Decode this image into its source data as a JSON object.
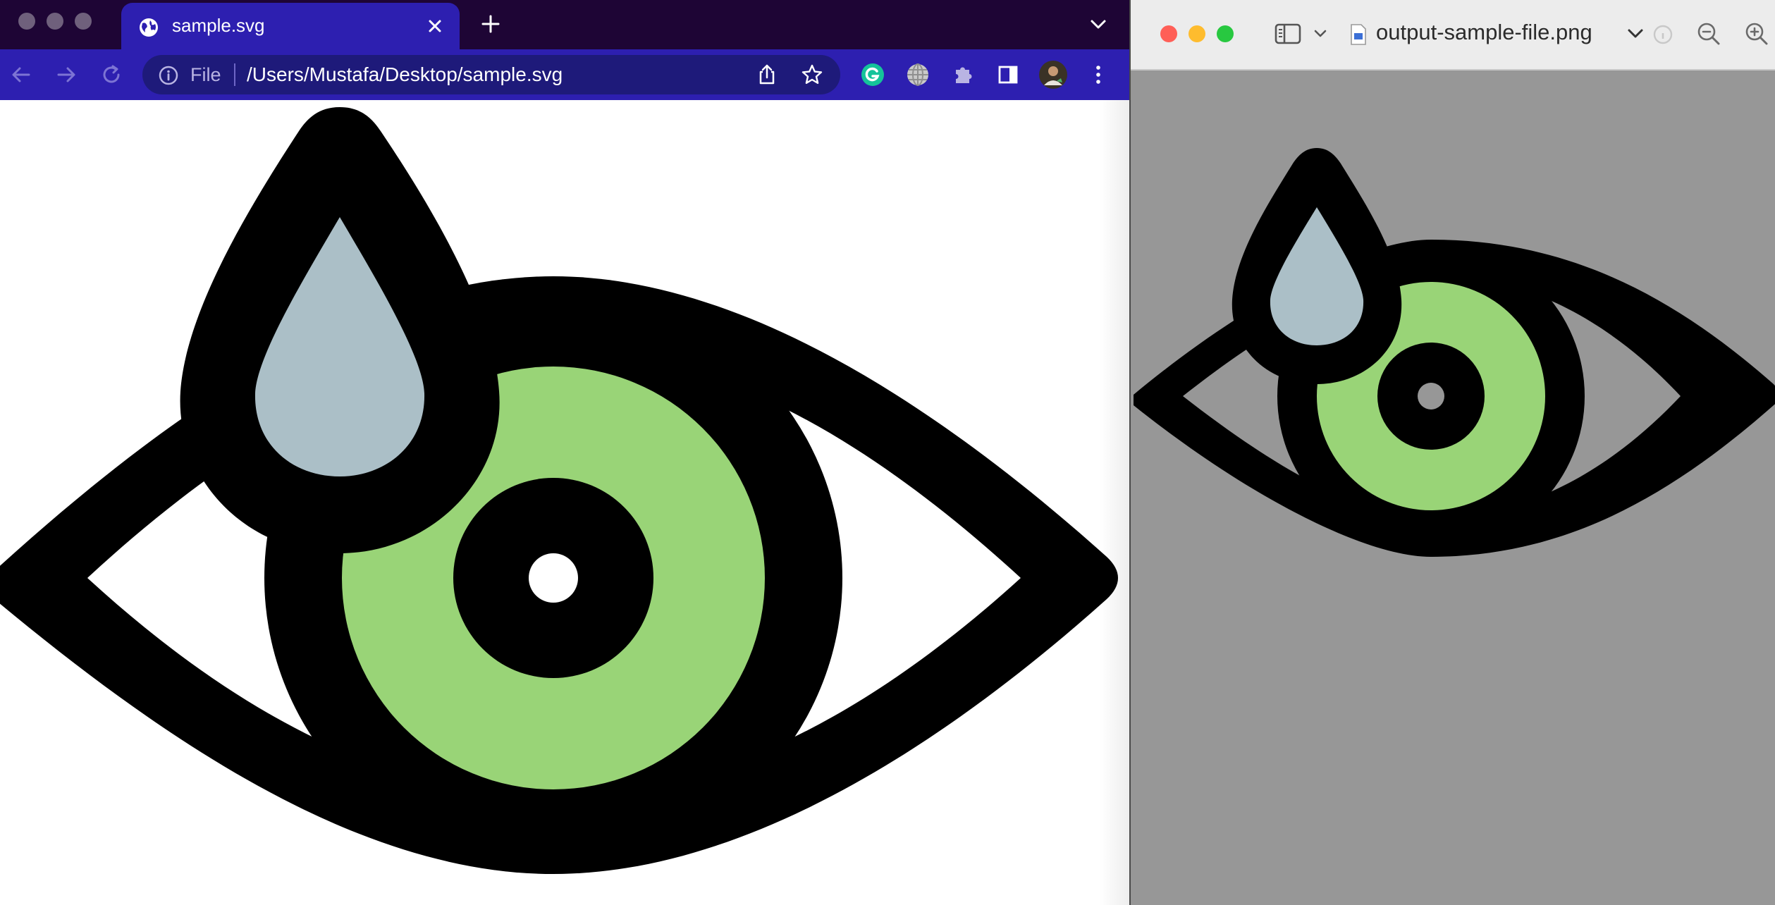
{
  "chrome": {
    "tab": {
      "title": "sample.svg",
      "icon": "globe-icon"
    },
    "toolbar": {
      "scheme_label": "File",
      "url": "/Users/Mustafa/Desktop/sample.svg"
    },
    "colors": {
      "titlebar": "#1e0535",
      "toolbar": "#2d1fb0",
      "omnibox": "#1e1a7a"
    }
  },
  "preview": {
    "filename": "output-sample-file.png",
    "background": "#979797"
  },
  "artwork": {
    "subject": "eye with teardrop",
    "colors": {
      "outline": "#000000",
      "iris": "#99d477",
      "tear": "#abbfc7",
      "sclera_chrome": "#ffffff",
      "sclera_preview": "#979797"
    }
  }
}
